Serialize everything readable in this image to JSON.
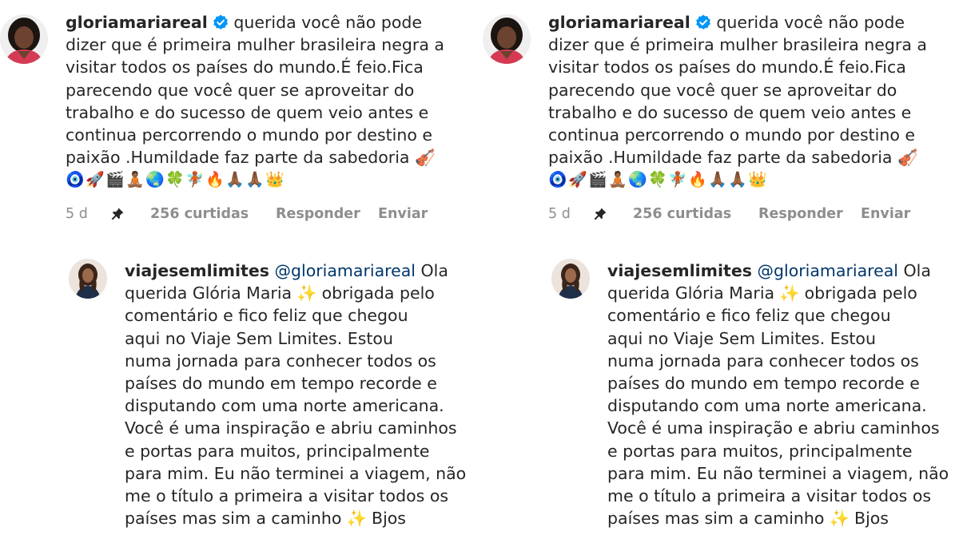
{
  "comment": {
    "username": "gloriamariareal",
    "verified_icon": "verified-badge-icon",
    "lines": [
      "querida você não pode",
      "dizer que é primeira mulher brasileira negra a",
      "visitar todos os países do mundo.É feio.Fica",
      "parecendo que você quer se aproveitar do",
      "trabalho e do sucesso de quem veio antes e",
      "continua percorrendo o mundo por destino e",
      "paixão .Humildade faz parte da sabedoria"
    ],
    "line7_emoji": "🎻",
    "emojis": [
      "🧿",
      "🚀",
      "🎬",
      "🧘🏾",
      "🌏",
      "🍀",
      "🧚🏾",
      "🔥",
      "🙏🏾",
      "🙏🏾",
      "👑"
    ],
    "time": "5 d",
    "pin_icon": "pin-icon",
    "likes": "256 curtidas",
    "reply_label": "Responder",
    "send_label": "Enviar"
  },
  "reply": {
    "username": "viajesemlimites",
    "mention": "@gloriamariareal",
    "line1_tail": "Ola",
    "line2_head": "querida Glória Maria",
    "line2_tail": "obrigada pelo",
    "sparkle": "✨",
    "lines": [
      "comentário e fico feliz que chegou",
      "aqui no Viaje Sem Limites. Estou",
      "numa jornada para conhecer todos os",
      "países do mundo em tempo recorde e",
      "disputando com uma norte americana.",
      "Você é uma inspiração e abriu caminhos",
      "e portas para muitos, principalmente",
      "para mim. Eu não terminei a viagem, não",
      "me o título a primeira a visitar todos os"
    ],
    "last_head": "países mas sim a caminho",
    "last_tail": "Bjos"
  },
  "colors": {
    "text": "#262626",
    "meta": "#8e8e8e",
    "mention": "#00376b",
    "verified": "#0095f6"
  }
}
